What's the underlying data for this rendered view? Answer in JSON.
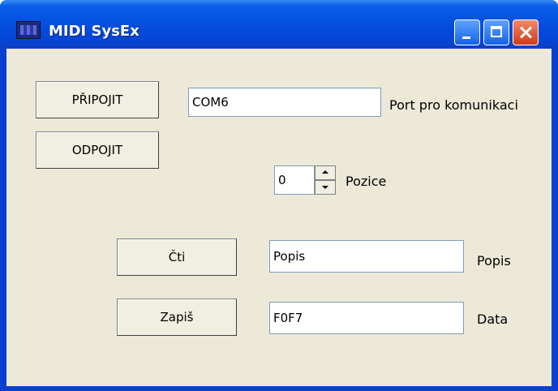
{
  "window": {
    "title": "MIDI SysEx"
  },
  "buttons": {
    "connect": "PŘIPOJIT",
    "disconnect": "ODPOJIT",
    "read": "Čti",
    "write": "Zapiš"
  },
  "port": {
    "value": "COM6",
    "label": "Port pro komunikaci"
  },
  "position": {
    "value": "0",
    "label": "Pozice"
  },
  "description": {
    "value": "Popis",
    "label": "Popis"
  },
  "data_field": {
    "value": "F0F7",
    "label": "Data"
  },
  "icons": [
    "app-icon",
    "minimize-icon",
    "maximize-icon",
    "close-icon",
    "spin-up-icon",
    "spin-down-icon"
  ]
}
